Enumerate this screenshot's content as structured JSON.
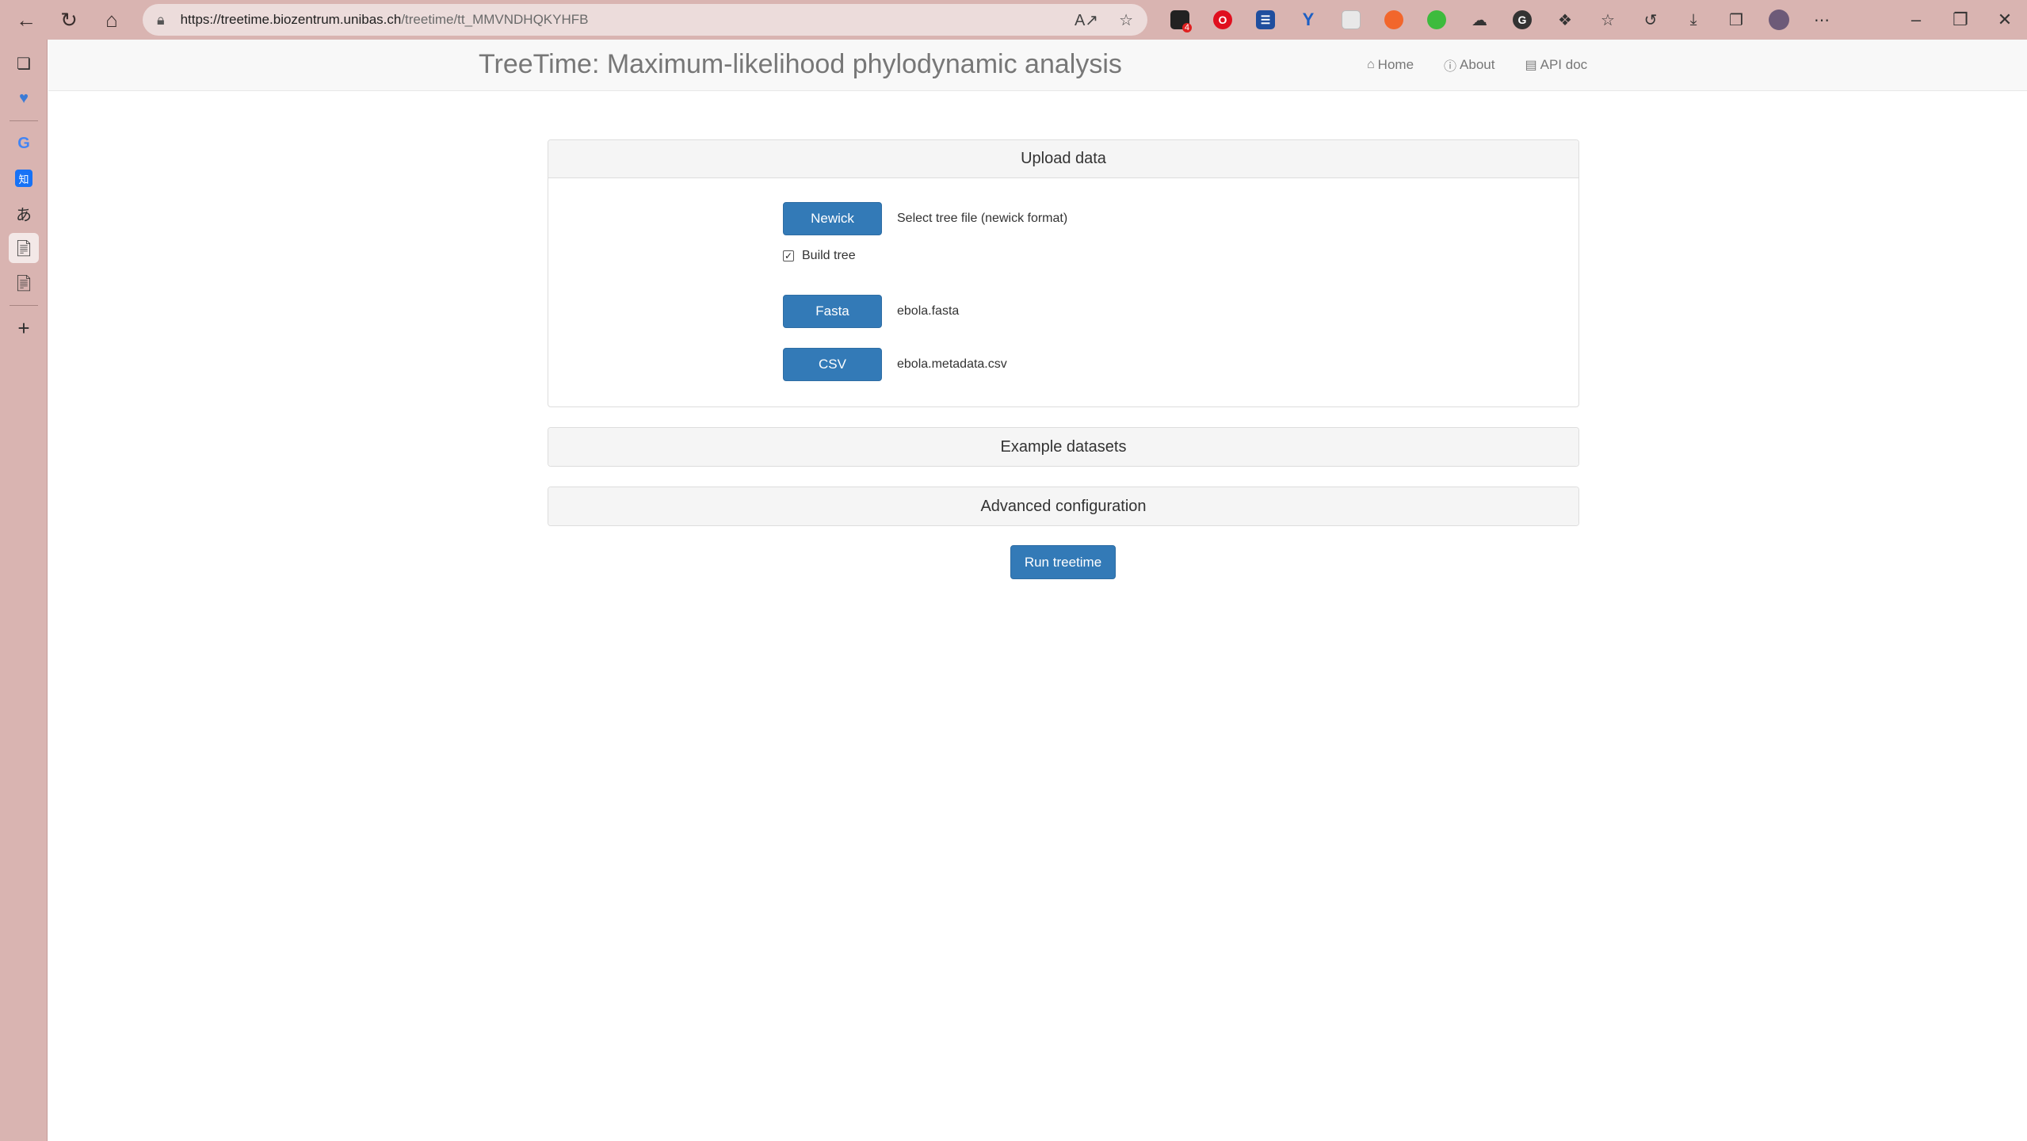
{
  "browser": {
    "url_host": "https://treetime.biozentrum.unibas.ch",
    "url_path": "/treetime/tt_MMVNDHQKYHFB",
    "extension_badge": "4"
  },
  "navbar": {
    "brand": "TreeTime: Maximum-likelihood phylodynamic analysis",
    "links": [
      {
        "label": "Home",
        "icon": "home-icon"
      },
      {
        "label": "About",
        "icon": "info-icon"
      },
      {
        "label": "API doc",
        "icon": "document-icon"
      }
    ]
  },
  "upload": {
    "heading": "Upload data",
    "newick_button": "Newick",
    "newick_file": "Select tree file (newick format)",
    "build_tree_label": "Build tree",
    "build_tree_checked": true,
    "fasta_button": "Fasta",
    "fasta_file": "ebola.fasta",
    "csv_button": "CSV",
    "csv_file": "ebola.metadata.csv"
  },
  "examples": {
    "heading": "Example datasets"
  },
  "advanced": {
    "heading": "Advanced configuration"
  },
  "run_button": "Run treetime"
}
